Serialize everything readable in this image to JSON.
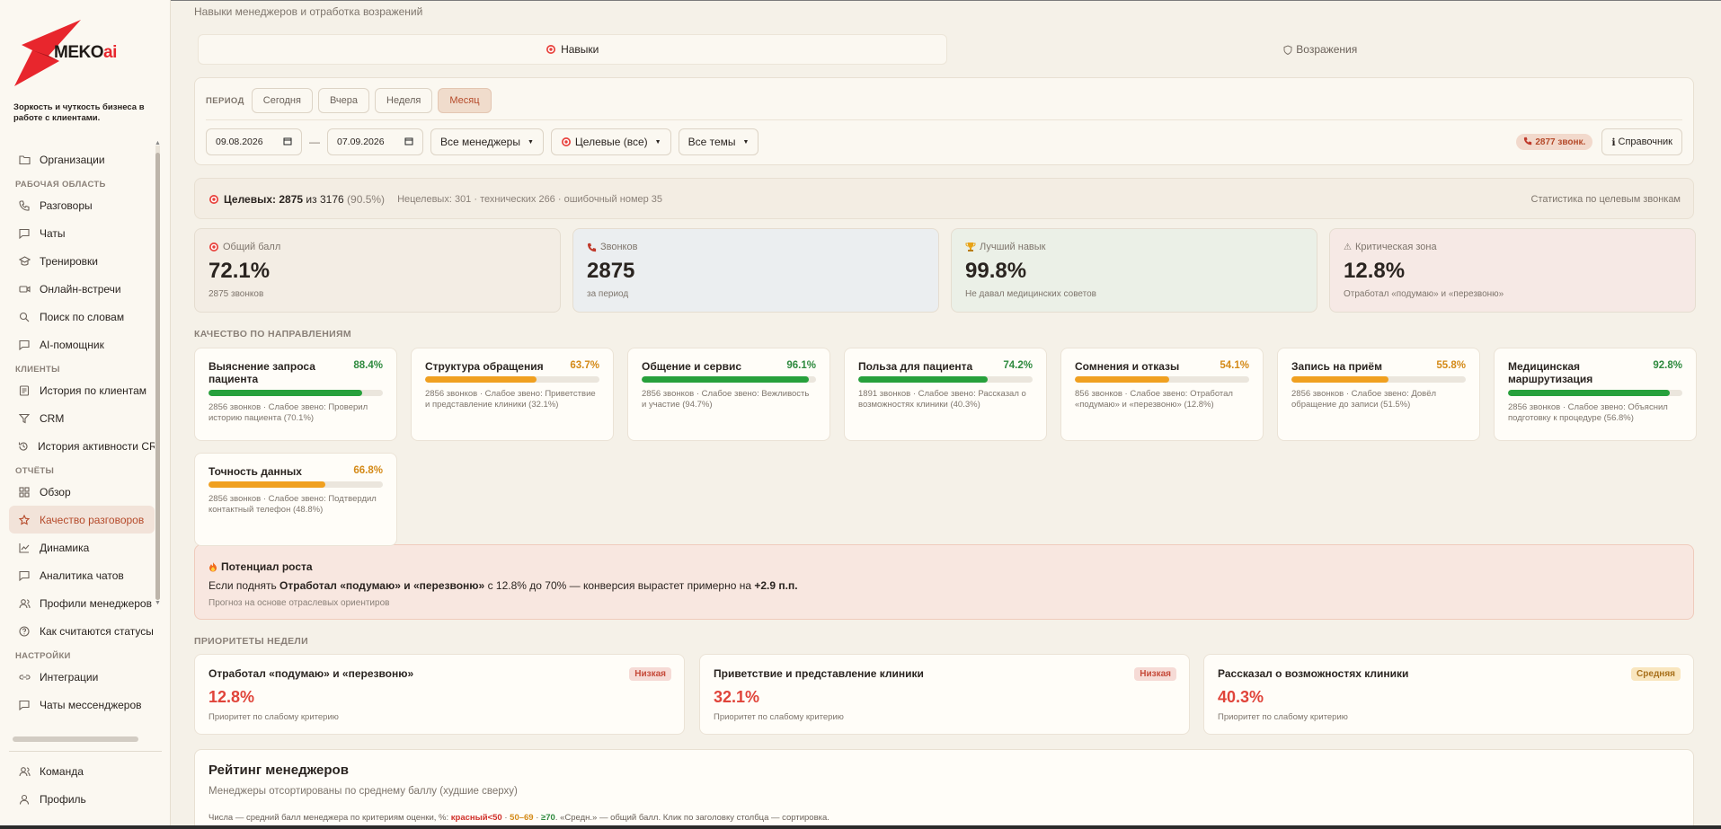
{
  "brand": {
    "name": "MEKO",
    "name_suffix": "ai",
    "tagline": "Зоркость и чуткость бизнеса в работе с клиентами.",
    "accent": "#e8262d"
  },
  "sidebar": {
    "top_items": [
      {
        "label": "Организации",
        "icon": "folder-icon"
      }
    ],
    "sections": [
      {
        "title": "РАБОЧАЯ ОБЛАСТЬ",
        "items": [
          {
            "label": "Разговоры",
            "icon": "phone-icon"
          },
          {
            "label": "Чаты",
            "icon": "chat-icon"
          },
          {
            "label": "Тренировки",
            "icon": "training-icon"
          },
          {
            "label": "Онлайн-встречи",
            "icon": "video-icon"
          },
          {
            "label": "Поиск по словам",
            "icon": "search-icon"
          },
          {
            "label": "AI-помощник",
            "icon": "bot-icon"
          }
        ]
      },
      {
        "title": "КЛИЕНТЫ",
        "items": [
          {
            "label": "История по клиентам",
            "icon": "list-icon"
          },
          {
            "label": "CRM",
            "icon": "filter-icon"
          },
          {
            "label": "История активности CRM",
            "icon": "history-icon"
          }
        ]
      },
      {
        "title": "ОТЧЁТЫ",
        "items": [
          {
            "label": "Обзор",
            "icon": "grid-icon"
          },
          {
            "label": "Качество разговоров",
            "icon": "star-icon",
            "active": true
          },
          {
            "label": "Динамика",
            "icon": "line-chart-icon"
          },
          {
            "label": "Аналитика чатов",
            "icon": "chat-analytics-icon"
          },
          {
            "label": "Профили менеджеров",
            "icon": "users-icon"
          },
          {
            "label": "Как считаются статусы",
            "icon": "help-icon"
          }
        ]
      },
      {
        "title": "НАСТРОЙКИ",
        "items": [
          {
            "label": "Интеграции",
            "icon": "link-icon"
          },
          {
            "label": "Чаты мессенджеров",
            "icon": "messenger-icon"
          }
        ]
      }
    ],
    "bottom_items": [
      {
        "label": "Команда",
        "icon": "team-icon"
      },
      {
        "label": "Профиль",
        "icon": "user-icon"
      }
    ]
  },
  "header": {
    "breadcrumb": "Навыки менеджеров и отработка возражений",
    "tabs": [
      {
        "label": "Навыки",
        "icon": "target-icon",
        "active": true
      },
      {
        "label": "Возражения",
        "icon": "shield-icon",
        "active": false
      }
    ]
  },
  "filters": {
    "period_label": "ПЕРИОД",
    "periods": [
      "Сегодня",
      "Вчера",
      "Неделя",
      "Месяц"
    ],
    "active_period": "Месяц",
    "date_from": "09.08.2026",
    "date_to": "07.09.2026",
    "date_sep": "—",
    "managers": "Все менеджеры",
    "target": "Целевые (все)",
    "topics": "Все темы",
    "calls_badge": "2877 звонк.",
    "reference_button": "Справочник"
  },
  "targets": {
    "label": "Целевых:",
    "value": "2875",
    "of": "из",
    "total": "3176",
    "percent": "(90.5%)",
    "details": "Нецелевых: 301 · технических 266 · ошибочный номер 35",
    "right": "Статистика по целевым звонкам"
  },
  "kpis": [
    {
      "title": "Общий балл",
      "value": "72.1%",
      "sub": "2875 звонков",
      "icon": "target-icon",
      "bg": "#f3ede4"
    },
    {
      "title": "Звонков",
      "value": "2875",
      "sub": "за период",
      "icon": "phone-red-icon",
      "bg": "#ebeef0"
    },
    {
      "title": "Лучший навык",
      "value": "99.8%",
      "sub": "Не давал медицинских советов",
      "icon": "trophy-icon",
      "bg": "#ebf0e7"
    },
    {
      "title": "Критическая зона",
      "value": "12.8%",
      "sub": "Отработал «подумаю» и «перезвоню»",
      "icon": "warning-icon",
      "bg": "#f6e9e5"
    }
  ],
  "quality": {
    "title": "КАЧЕСТВО ПО НАПРАВЛЕНИЯМ",
    "items": [
      {
        "name": "Выяснение запроса пациента",
        "percent": "88.4%",
        "value": 88.4,
        "desc": "2856 звонков · Слабое звено: Проверил историю пациента (70.1%)"
      },
      {
        "name": "Структура обращения",
        "percent": "63.7%",
        "value": 63.7,
        "desc": "2856 звонков · Слабое звено: Приветствие и представление клиники (32.1%)"
      },
      {
        "name": "Общение и сервис",
        "percent": "96.1%",
        "value": 96.1,
        "desc": "2856 звонков · Слабое звено: Вежливость и участие (94.7%)"
      },
      {
        "name": "Польза для пациента",
        "percent": "74.2%",
        "value": 74.2,
        "desc": "1891 звонков · Слабое звено: Рассказал о возможностях клиники (40.3%)"
      },
      {
        "name": "Сомнения и отказы",
        "percent": "54.1%",
        "value": 54.1,
        "desc": "856 звонков · Слабое звено: Отработал «подумаю» и «перезвоню» (12.8%)"
      },
      {
        "name": "Запись на приём",
        "percent": "55.8%",
        "value": 55.8,
        "desc": "2856 звонков · Слабое звено: Довёл обращение до записи (51.5%)"
      },
      {
        "name": "Медицинская маршрутизация",
        "percent": "92.8%",
        "value": 92.8,
        "desc": "2856 звонков · Слабое звено: Объяснил подготовку к процедуре (56.8%)"
      },
      {
        "name": "Точность данных",
        "percent": "66.8%",
        "value": 66.8,
        "desc": "2856 звонков · Слабое звено: Подтвердил контактный телефон (48.8%)"
      }
    ]
  },
  "growth": {
    "title": "Потенциал роста",
    "text_pre": "Если поднять",
    "criterion": "Отработал «подумаю» и «перезвоню»",
    "text_mid": "с 12.8% до 70% — конверсия вырастет примерно на",
    "delta": "+2.9 п.п.",
    "note": "Прогноз на основе отраслевых ориентиров"
  },
  "priorities": {
    "title": "ПРИОРИТЕТЫ НЕДЕЛИ",
    "items": [
      {
        "name": "Отработал «подумаю» и «перезвоню»",
        "value": "12.8%",
        "badge": "Низкая",
        "level": "low",
        "sub": "Приоритет по слабому критерию"
      },
      {
        "name": "Приветствие и представление клиники",
        "value": "32.1%",
        "badge": "Низкая",
        "level": "low",
        "sub": "Приоритет по слабому критерию"
      },
      {
        "name": "Рассказал о возможностях клиники",
        "value": "40.3%",
        "badge": "Средняя",
        "level": "mid",
        "sub": "Приоритет по слабому критерию"
      }
    ]
  },
  "rating": {
    "title": "Рейтинг менеджеров",
    "subtitle": "Менеджеры отсортированы по среднему баллу (худшие сверху)",
    "legend_pre": "Числа — средний балл менеджера по критериям оценки, %:",
    "legend_red": "красный<50",
    "legend_dot1": "·",
    "legend_orange": "50–69",
    "legend_dot2": "·",
    "legend_green": "≥70",
    "legend_post": ". «Средн.» — общий балл. Клик по заголовку столбца — сортировка."
  }
}
